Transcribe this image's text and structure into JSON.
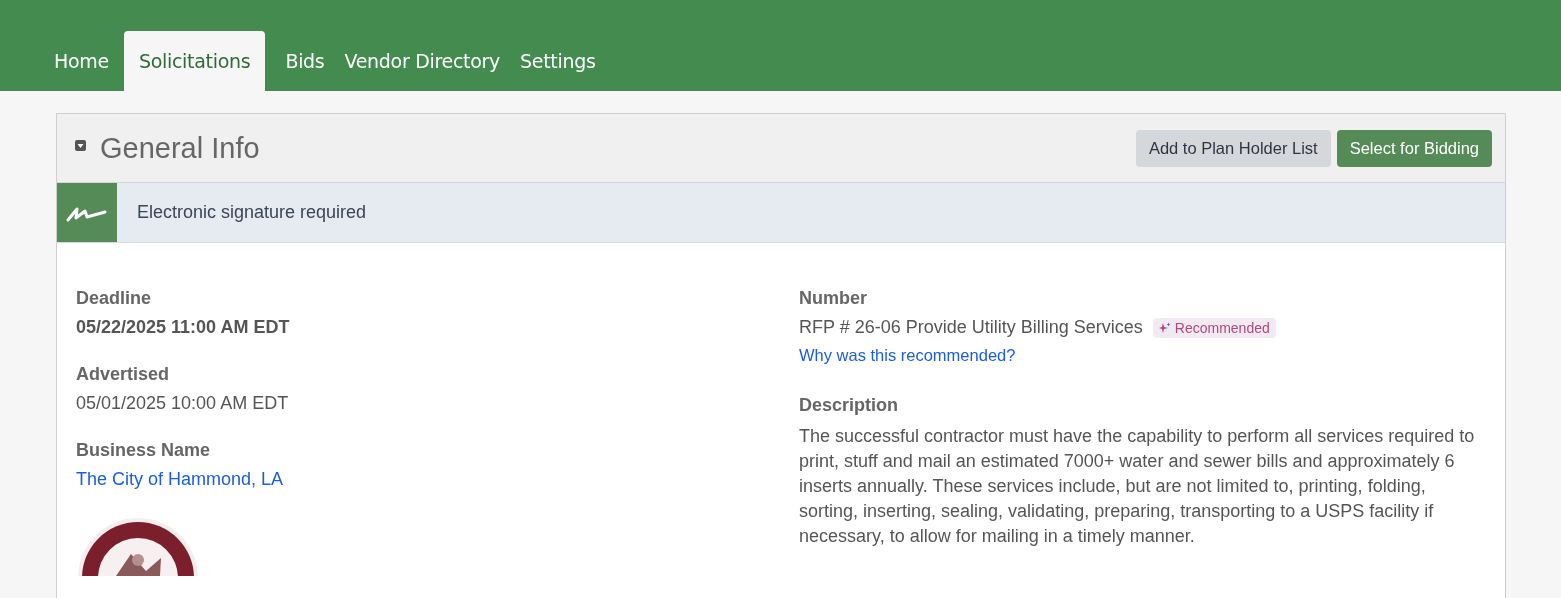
{
  "nav": {
    "tabs": [
      {
        "label": "Home",
        "selected": false
      },
      {
        "label": "Solicitations",
        "selected": true
      },
      {
        "label": "Bids",
        "selected": false
      },
      {
        "label": "Vendor Directory",
        "selected": false
      },
      {
        "label": "Settings",
        "selected": false
      }
    ]
  },
  "panel": {
    "title": "General Info",
    "expanded": true,
    "buttons": [
      {
        "label": "Add to Plan Holder List",
        "kind": "secondary"
      },
      {
        "label": "Select for Bidding",
        "kind": "primary"
      }
    ],
    "notice": "Electronic signature required",
    "left_fields": [
      {
        "label": "Deadline",
        "value": "05/22/2025 11:00 AM EDT",
        "kind": "bold"
      },
      {
        "label": "Advertised",
        "value": "05/01/2025 10:00 AM EDT",
        "kind": "plain"
      },
      {
        "label": "Business Name",
        "value": "The City of Hammond, LA",
        "kind": "link"
      }
    ],
    "number": {
      "label": "Number",
      "value": "RFP # 26-06 Provide Utility Billing Services",
      "badge": "Recommended",
      "link": "Why was this recommended?"
    },
    "description": {
      "label": "Description",
      "text": "The successful contractor must have the capability to perform all services required to print, stuff and mail an estimated 7000+ water and sewer bills and approximately 6 inserts annually. These services include, but are not limited to, printing, folding, sorting, inserting, sealing, validating, preparing, transporting to a USPS facility if necessary, to allow for mailing in a timely manner."
    }
  }
}
